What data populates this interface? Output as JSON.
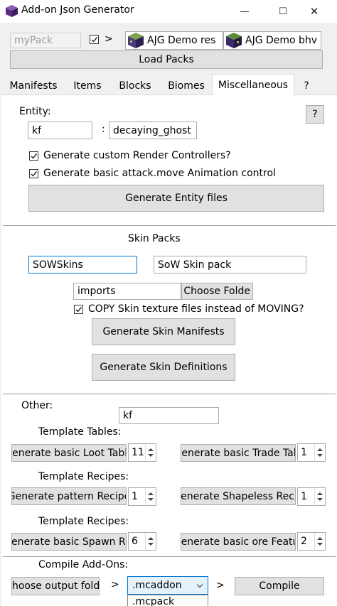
{
  "window": {
    "title": "Add-on Json Generator",
    "minimize": "—",
    "maximize": "☐",
    "close": "✕"
  },
  "packs": {
    "name_value": "myPack",
    "link_arrow": ">",
    "res_pack_name": "AJG Demo res",
    "bhv_pack_name": "AJG Demo bhv",
    "load_button": "Load Packs"
  },
  "tabs": [
    "Manifests",
    "Items",
    "Blocks",
    "Biomes",
    "Miscellaneous",
    "?"
  ],
  "active_tab": "Miscellaneous",
  "entity": {
    "heading": "Entity:",
    "help": "?",
    "namespace": "kf",
    "separator": ":",
    "name": "decaying_ghost",
    "render_controllers_label": "Generate custom Render Controllers?",
    "attack_animation_label": "Generate basic attack.move Animation control",
    "generate_button": "Generate Entity files"
  },
  "skins": {
    "heading": "Skin Packs",
    "id": "SOWSkins",
    "display_name": "SoW Skin pack",
    "folder": "imports",
    "choose_folder_button": "or Choose Folde",
    "copy_label": "COPY Skin texture files instead of MOVING?",
    "manifests_button": "Generate Skin Manifests",
    "definitions_button": "Generate Skin Definitions"
  },
  "other": {
    "heading": "Other:",
    "namespace": "kf",
    "template_tables_label": "Template Tables:",
    "loot_button": "Generate basic Loot Table",
    "loot_count": "11",
    "trade_button": "Generate basic Trade Tabl",
    "trade_count": "1",
    "template_recipes_label": "Template Recipes:",
    "pattern_button": "Generate pattern Recipe",
    "pattern_count": "1",
    "shapeless_button": "Generate Shapeless Recip",
    "shapeless_count": "1",
    "template_recipes_label_2": "Template Recipes:",
    "spawn_button": "Generate basic Spawn Rul",
    "spawn_count": "6",
    "ore_button": "Generate basic ore Featur",
    "ore_count": "2"
  },
  "compile": {
    "heading": "Compile Add-Ons:",
    "output_button": "Choose output folde",
    "arrow1": ">",
    "format_selected": ".mcaddon",
    "arrow2": ">",
    "compile_button": "Compile",
    "format_option_2": ".mcpack"
  }
}
